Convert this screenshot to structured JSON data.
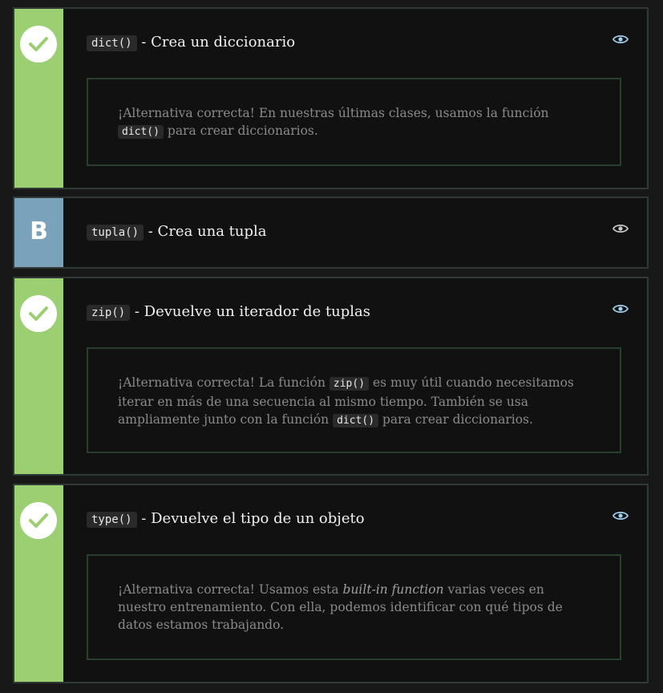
{
  "cards": [
    {
      "status": "correct",
      "title_code": "dict()",
      "title_text": " - Crea un diccionario",
      "feedback": {
        "before": "¡Alternativa correcta! En nuestras últimas clases, usamos la función ",
        "code1": "dict()",
        "after": " para crear diccionarios."
      }
    },
    {
      "status": "option",
      "letter": "B",
      "title_code": "tupla()",
      "title_text": " - Crea una tupla"
    },
    {
      "status": "correct",
      "title_code": "zip()",
      "title_text": " - Devuelve un iterador de tuplas",
      "feedback": {
        "before": "¡Alternativa correcta! La función ",
        "code1": "zip()",
        "middle": " es muy útil cuando necesitamos iterar en más de una secuencia al mismo tiempo. También se usa ampliamente junto con la función ",
        "code2": "dict()",
        "after": " para crear diccionarios."
      }
    },
    {
      "status": "correct",
      "title_code": "type()",
      "title_text": " - Devuelve el tipo de un objeto",
      "feedback": {
        "before": "¡Alternativa correcta! Usamos esta ",
        "emph": "built-in function",
        "after": " varias veces en nuestro entrenamiento. Con ella, podemos identificar con qué tipos de datos estamos trabajando."
      }
    }
  ],
  "colors": {
    "correct": "#9bcf72",
    "option": "#7aa2ba",
    "eye": "#9fd0f0",
    "background": "#111111"
  },
  "icons": {
    "status_correct": "check-circle-icon",
    "toggle": "eye-icon"
  }
}
